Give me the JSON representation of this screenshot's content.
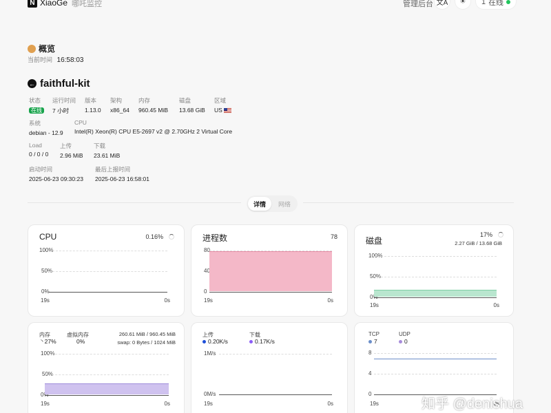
{
  "header": {
    "logo_letter": "N",
    "brand": "XiaoGe",
    "subtitle": "哪吒监控",
    "admin": "管理后台",
    "lang_icon": "translate-icon",
    "theme_icon": "sun-icon",
    "online_count": "1",
    "online_label": "在线"
  },
  "overview": {
    "title": "概览",
    "time_label": "当前时间",
    "time_value": "16:58:03"
  },
  "server": {
    "name": "faithful-kit",
    "fields": {
      "status_k": "状态",
      "status_v": "在线",
      "uptime_k": "运行时间",
      "uptime_v": "7 小时",
      "version_k": "版本",
      "version_v": "1.13.0",
      "arch_k": "架构",
      "arch_v": "x86_64",
      "mem_k": "内存",
      "mem_v": "960.45 MiB",
      "disk_k": "磁盘",
      "disk_v": "13.68 GiB",
      "region_k": "区域",
      "region_v": "US",
      "os_k": "系统",
      "os_v": "debian - 12.9",
      "cpu_k": "CPU",
      "cpu_v": "Intel(R) Xeon(R) CPU E5-2697 v2 @ 2.70GHz 2 Virtual Core",
      "load_k": "Load",
      "load_v": "0 / 0 / 0",
      "up_k": "上传",
      "up_v": "2.96 MiB",
      "down_k": "下载",
      "down_v": "23.61 MiB",
      "boot_k": "启动时间",
      "boot_v": "2025-06-23 09:30:23",
      "last_k": "最后上报时间",
      "last_v": "2025-06-23 16:58:01"
    }
  },
  "tabs": {
    "detail": "详情",
    "network": "网络"
  },
  "cards": {
    "cpu": {
      "title": "CPU",
      "value": "0.16%",
      "y_top": "100%",
      "y_mid": "50%",
      "y_bot": "0%",
      "x_start": "19s",
      "x_end": "0s",
      "level_pct": 0.16
    },
    "proc": {
      "title": "进程数",
      "value": "78",
      "y_top": "80",
      "y_mid": "40",
      "y_bot": "0",
      "x_start": "19s",
      "x_end": "0s",
      "count": 78,
      "y_max": 80
    },
    "disk": {
      "title": "磁盘",
      "value": "17%",
      "detail": "2.27 GiB / 13.68 GiB",
      "y_top": "100%",
      "y_mid": "50%",
      "y_bot": "0%",
      "x_start": "19s",
      "x_end": "0s",
      "level_pct": 17
    },
    "mem": {
      "mem_label": "内存",
      "mem_value": "27%",
      "swap_label": "虚拟内存",
      "swap_value": "0%",
      "detail1": "260.61 MiB / 960.45 MiB",
      "detail2": "swap: 0 Bytes / 1024 MiB",
      "y_top": "100%",
      "y_mid": "50%",
      "y_bot": "0%",
      "x_start": "19s",
      "x_end": "0s",
      "level_pct": 27
    },
    "net": {
      "up_label": "上传",
      "up_value": "0.20K/s",
      "down_label": "下载",
      "down_value": "0.17K/s",
      "y_top": "1M/s",
      "y_bot": "0M/s",
      "x_start": "19s",
      "x_end": "0s"
    },
    "conn": {
      "tcp_label": "TCP",
      "tcp_value": "7",
      "udp_label": "UDP",
      "udp_value": "0",
      "y_top": "8",
      "y_mid": "4",
      "y_bot": "0",
      "x_start": "19s",
      "x_end": "0s",
      "tcp": 7,
      "y_max": 8
    }
  },
  "colors": {
    "proc_fill": "#f4b8c8",
    "disk_fill": "#b9e6cf",
    "mem_fill": "#cfc2ef",
    "tcp_line": "#6b8ec9",
    "net_up": "#1d4ed8",
    "net_down": "#8b5cf6",
    "online_dot": "#22c55e"
  },
  "watermark": "知乎 @denishua"
}
